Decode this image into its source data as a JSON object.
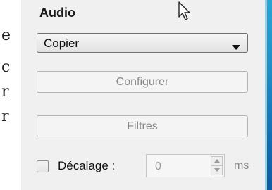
{
  "left_text": [
    "e",
    "c",
    "r",
    "r"
  ],
  "audio": {
    "title": "Audio",
    "mode_select": {
      "value": "Copier"
    },
    "configure_label": "Configurer",
    "filters_label": "Filtres",
    "offset": {
      "label": "Décalage :",
      "checked": false,
      "value": "0",
      "unit": "ms"
    }
  },
  "icons": [
    "mouse-cursor-icon",
    "dropdown-arrow-icon",
    "spin-up-icon",
    "spin-down-icon",
    "checkbox-icon"
  ],
  "colors": {
    "panel_bg": "#f0f0f0",
    "accent_bar": "#1f8fc7",
    "disabled_text": "#8a8a8a"
  }
}
